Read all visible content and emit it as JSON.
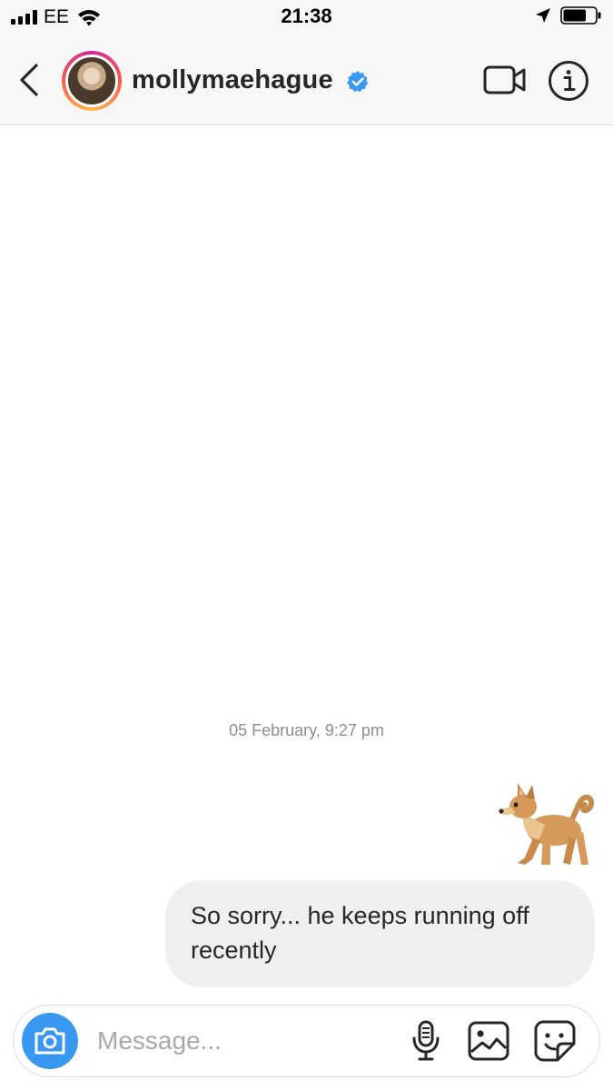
{
  "status_bar": {
    "carrier": "EE",
    "time": "21:38",
    "signal_bars": 4,
    "battery_level": 0.7
  },
  "header": {
    "username": "mollymaehague",
    "verified": true,
    "back_icon": "chevron-left-icon",
    "video_icon": "video-camera-icon",
    "info_icon": "info-icon"
  },
  "conversation": {
    "timestamp": "05 February, 9:27 pm",
    "messages": [
      {
        "type": "emoji",
        "content": "dog-emoji"
      },
      {
        "type": "text",
        "text": "So sorry... he keeps running off recently"
      }
    ]
  },
  "composer": {
    "placeholder": "Message...",
    "value": ""
  },
  "colors": {
    "accent": "#3897f0",
    "bubble": "#efefef",
    "header_bg": "#f7f7f7",
    "muted_text": "#8e8e8e",
    "verified": "#3897f0"
  }
}
